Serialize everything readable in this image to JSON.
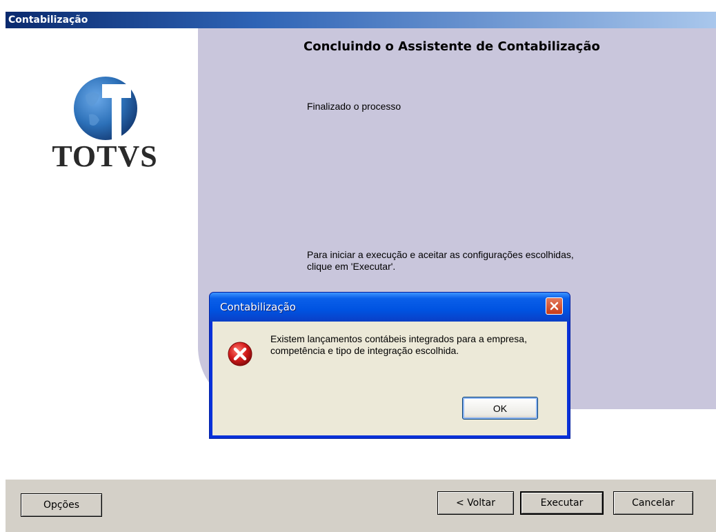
{
  "window": {
    "title": "Contabilização"
  },
  "logo": {
    "text": "TOTVS",
    "icon": "totvs-globe-icon",
    "colors": {
      "globe": "#2c70b8",
      "letter": "#ffffff"
    }
  },
  "wizard": {
    "title": "Concluindo o Assistente de Contabilização",
    "status": "Finalizado o processo",
    "instruction": "Para iniciar a execução e aceitar as configurações escolhidas, clique em 'Executar'."
  },
  "footer": {
    "options_label": "Opções",
    "back_label": "< Voltar",
    "execute_label": "Executar",
    "cancel_label": "Cancelar"
  },
  "dialog": {
    "title": "Contabilização",
    "close_icon": "close-icon",
    "error_icon": "error-icon",
    "message": "Existem lançamentos contábeis integrados para a empresa, competência e tipo de integração escolhida.",
    "ok_label": "OK"
  },
  "colors": {
    "panel_background": "#c9c6dc",
    "titlebar_start": "#0a2a6e",
    "dialog_blue": "#0831d9",
    "error_red": "#d31b1b"
  }
}
